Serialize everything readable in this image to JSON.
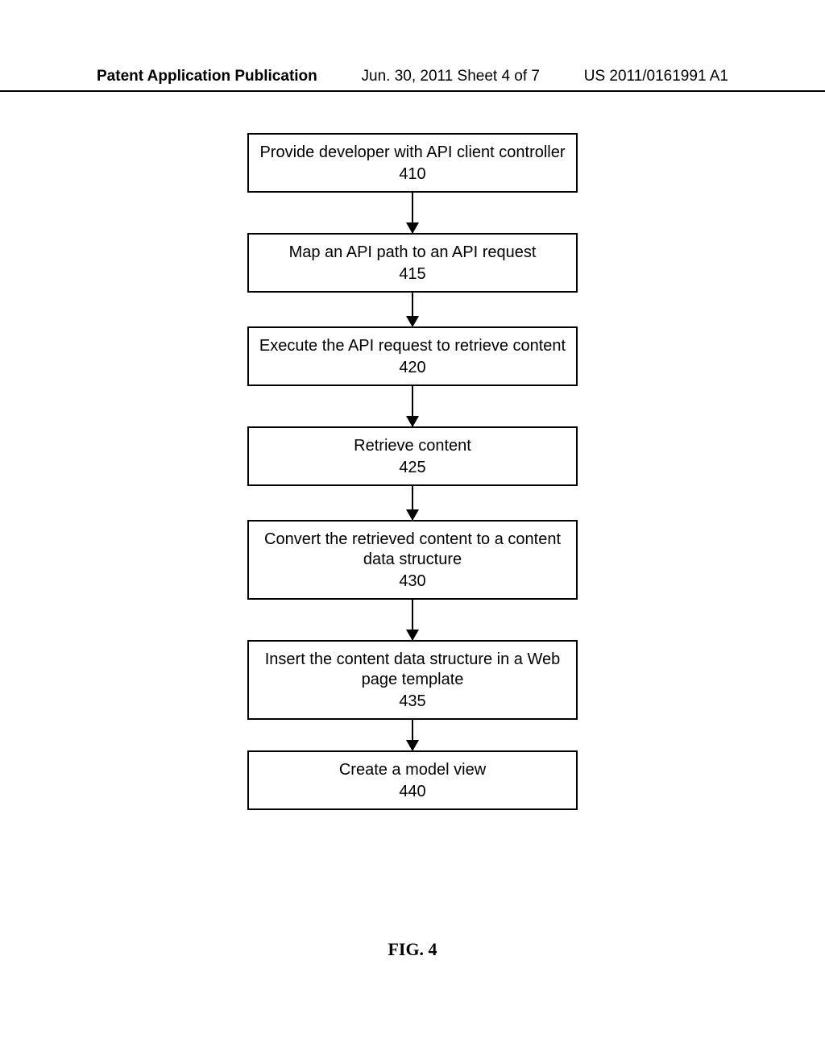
{
  "header": {
    "left": "Patent Application Publication",
    "mid": "Jun. 30, 2011  Sheet 4 of 7",
    "right": "US 2011/0161991 A1"
  },
  "flow": {
    "steps": [
      {
        "text": "Provide developer with API client controller",
        "num": "410"
      },
      {
        "text": "Map an API path to an API request",
        "num": "415"
      },
      {
        "text": "Execute the API request to retrieve content",
        "num": "420"
      },
      {
        "text": "Retrieve content",
        "num": "425"
      },
      {
        "text": "Convert the retrieved content to a content data structure",
        "num": "430"
      },
      {
        "text": "Insert the content data structure in a Web page template",
        "num": "435"
      },
      {
        "text": "Create a model view",
        "num": "440"
      }
    ]
  },
  "figure_label": "FIG. 4"
}
